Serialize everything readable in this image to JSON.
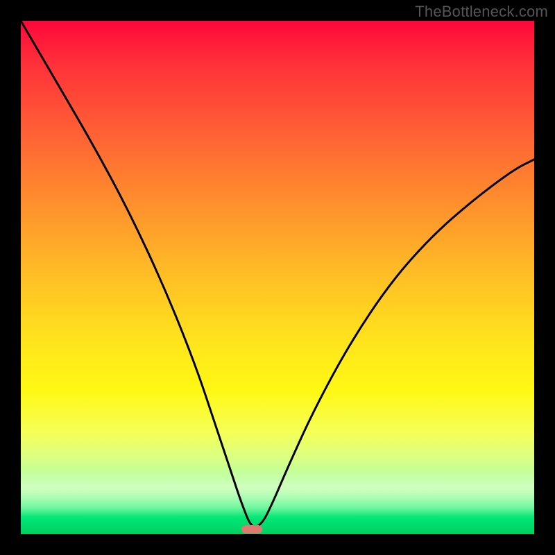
{
  "attribution": "TheBottleneck.com",
  "chart_data": {
    "type": "line",
    "title": "",
    "xlabel": "",
    "ylabel": "",
    "xlim": [
      0,
      100
    ],
    "ylim": [
      0,
      100
    ],
    "grid": false,
    "legend": false,
    "marker": {
      "x": 45,
      "y": 1
    },
    "series": [
      {
        "name": "bottleneck-curve",
        "x": [
          0,
          7,
          14,
          21,
          28,
          34,
          38,
          41,
          43,
          45,
          47,
          49,
          52,
          57,
          64,
          72,
          80,
          88,
          96,
          100
        ],
        "values": [
          100,
          88,
          76,
          63,
          48,
          33,
          21,
          12,
          6,
          1,
          2,
          6,
          13,
          24,
          37,
          49,
          58,
          65,
          71,
          73
        ]
      }
    ]
  }
}
